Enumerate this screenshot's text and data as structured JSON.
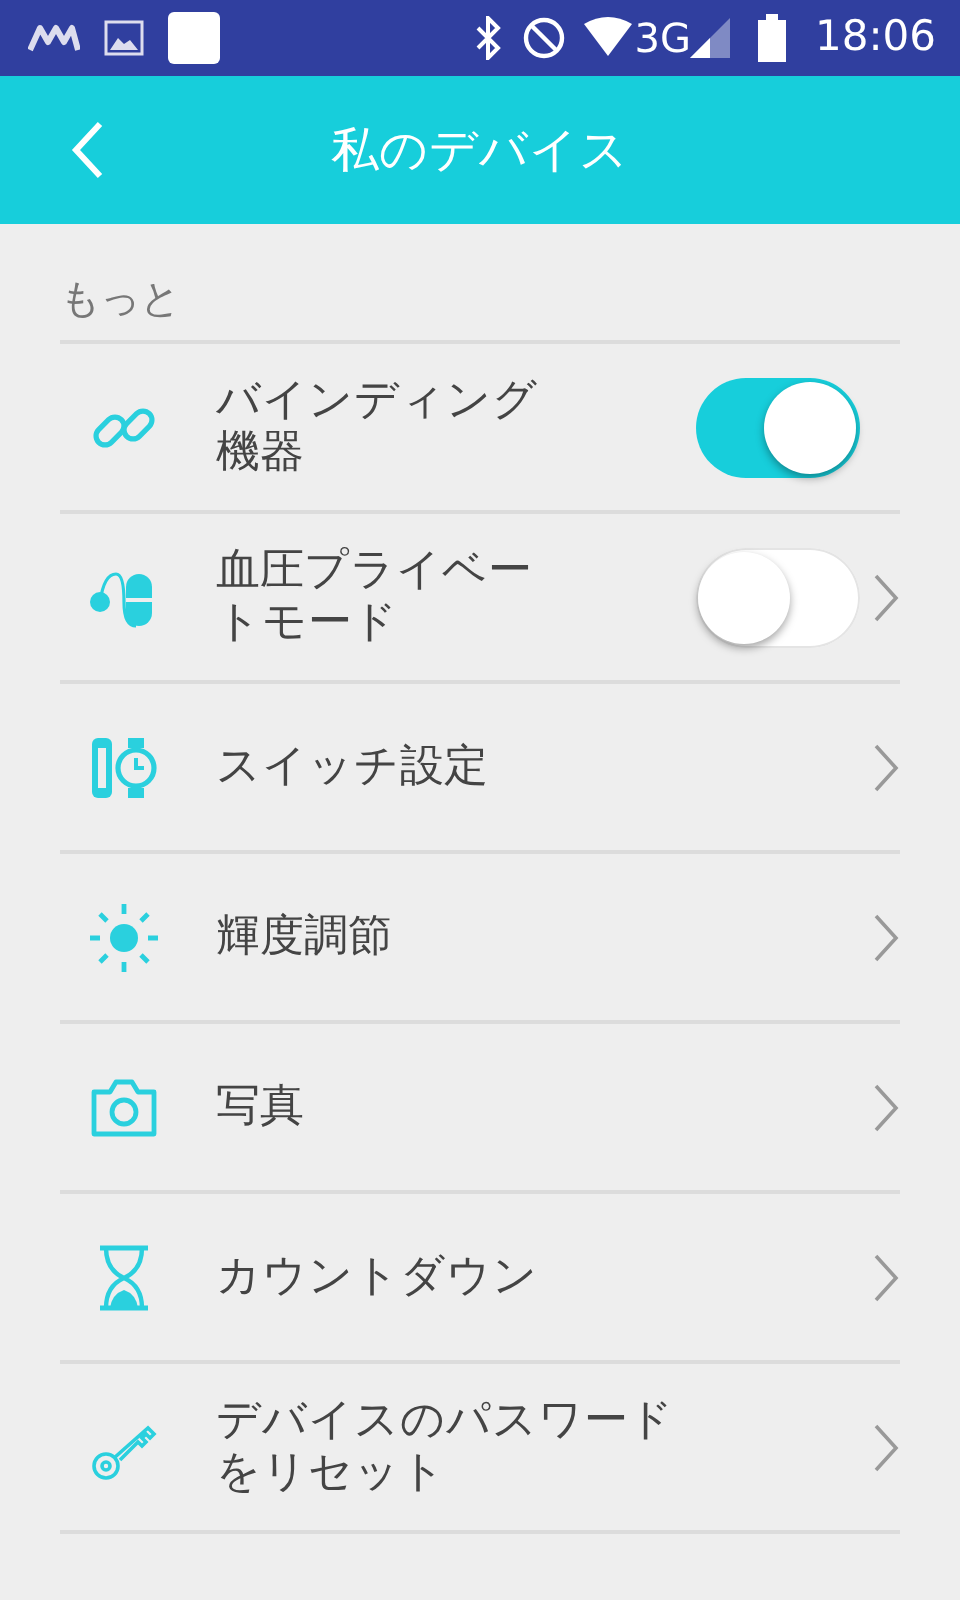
{
  "status_bar": {
    "time": "18:06",
    "network": "3G"
  },
  "header": {
    "title": "私のデバイス"
  },
  "section": {
    "label": "もっと"
  },
  "items": [
    {
      "label": "バインディング機器",
      "kind": "toggle",
      "on": true,
      "chevron": false
    },
    {
      "label": "血圧プライベートモード",
      "kind": "toggle",
      "on": false,
      "chevron": true
    },
    {
      "label": "スイッチ設定",
      "kind": "link",
      "chevron": true
    },
    {
      "label": "輝度調節",
      "kind": "link",
      "chevron": true
    },
    {
      "label": "写真",
      "kind": "link",
      "chevron": true
    },
    {
      "label": "カウントダウン",
      "kind": "link",
      "chevron": true
    },
    {
      "label": "デバイスのパスワードをリセット",
      "kind": "link",
      "chevron": true
    }
  ]
}
